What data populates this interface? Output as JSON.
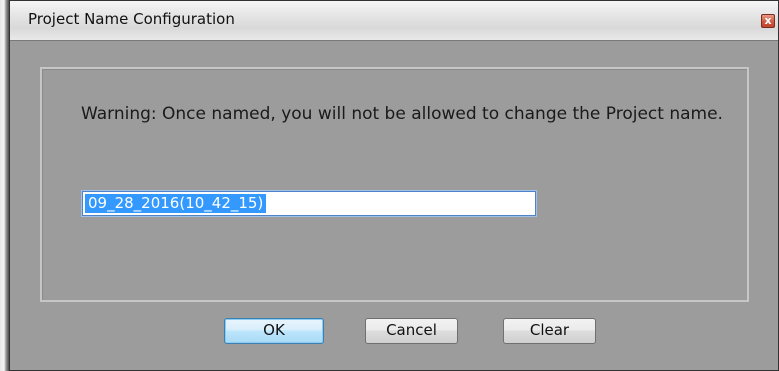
{
  "window": {
    "title": "Project Name Configuration",
    "close_glyph": "x"
  },
  "dialog": {
    "warning_text": "Warning: Once named, you will not be allowed to change the Project name.",
    "project_name_value": "09_28_2016(10_42_15)"
  },
  "buttons": {
    "ok_label": "OK",
    "cancel_label": "Cancel",
    "clear_label": "Clear"
  },
  "colors": {
    "dialog_background": "#9c9c9c",
    "selection_highlight": "#3399ff",
    "focus_border": "#4e83c6",
    "close_button": "#c0432b"
  },
  "icons": {
    "close": "close-icon"
  }
}
